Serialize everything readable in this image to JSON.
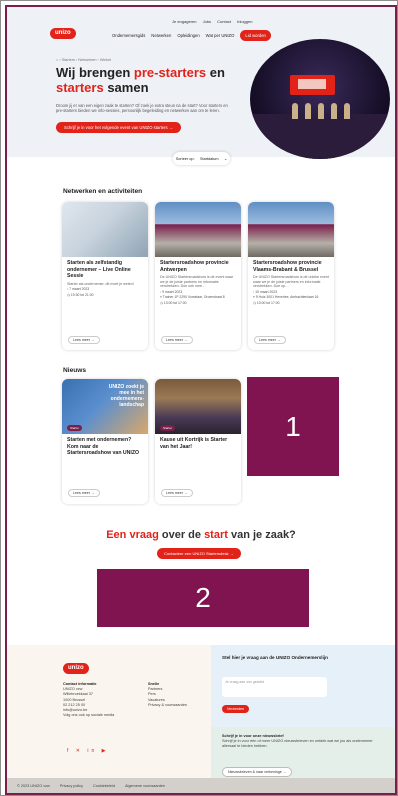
{
  "header": {
    "logo": "unizo",
    "top_nav": [
      "Je engageren",
      "Jobs",
      "Contact",
      "Inloggen"
    ],
    "main_nav": [
      "Ondernemersgids",
      "Netwerken",
      "Opleidingen",
      "Wat per UNIZO"
    ],
    "nav_cta": "Lid worden",
    "breadcrumb": "⌂ › Starters › Netwerken › Winkel"
  },
  "hero": {
    "title_part1": "Wij brengen ",
    "title_highlight1": "pre-starters",
    "title_part2": " en ",
    "title_highlight2": "starters",
    "title_part3": " samen",
    "description": "Droom jij er van een eigen zaak te starten? Of zoek je extra steun na de start? Voor starters en pre-starters bieden we info-sessies, persoonlijk begeleiding en netwerken aan om te leren.",
    "button": "Schrijf je in voor het volgende event van UNIZO starters →"
  },
  "filter": {
    "label": "Sorteer op:",
    "value": "Startdatum"
  },
  "events": {
    "title": "Netwerken en activiteiten",
    "cards": [
      {
        "title": "Starten als zelfstandig ondernemer – Live Online Sessie",
        "desc": "Starter als ondernemer, dit moet je weten!",
        "date": "7 maart 2023",
        "location": "19:30 tot 21:00",
        "more": "Lees meer →"
      },
      {
        "title": "Startersroadshow provincie Antwerpen",
        "desc": "De UNIZO Startersroadshow is dé event waar we je de juiste partners en informatie verstrekken. Doe ook mee…",
        "date": "9 maart 2023",
        "location": "Trainer 1P 2290 Vorselaar, Groenstraat 8",
        "time": "13:00 tot 17:00",
        "more": "Lees meer →"
      },
      {
        "title": "Startersroadshow provincie Vlaams-Brabant & Brussel",
        "desc": "De UNIZO Startersroadshow is dé unieke event waar we je de juiste partners en informatie verstrekken. Doe op…",
        "date": "15 maart 2023",
        "location": "9 Huis 3001 Heverlee, Ambachtenlaan 16",
        "time": "13:00 tot 17:00",
        "more": "Lees meer →"
      }
    ]
  },
  "news": {
    "title": "Nieuws",
    "cards": [
      {
        "tag": "Starter",
        "overlay": "UNIZO zoekt je mee in het ondernemers-landschap",
        "title": "Starten met ondernemen? Kom naar de Startersroadshow van UNIZO",
        "more": "Lees meer →"
      },
      {
        "tag": "Starter",
        "title": "Kause uit Kortrijk is Starter van het Jaar!",
        "more": "Lees meer →"
      }
    ]
  },
  "redactions": {
    "box1": "1",
    "box2": "2"
  },
  "question": {
    "highlight1": "Een vraag",
    "middle": " over de ",
    "highlight2": "start",
    "end": " van je zaak?",
    "button": "Contacteer een UNIZO Startersdesk →"
  },
  "footer": {
    "logo": "unizo",
    "contact_title": "Contact informatie",
    "contact_lines": [
      "UNIZO vzw",
      "Willebroekkaai 37",
      "1000 Brussel",
      "02 212 25 00",
      "info@unizo.be"
    ],
    "social_label": "Volg ons ook op sociale media",
    "social_icons": "f ✕ in ▶",
    "quick_title": "Snelle",
    "quick_links": [
      "Partners",
      "Pers",
      "Vacatures",
      "Privacy & voorwaarden"
    ],
    "question_title": "Stel hier je vraag aan de UNIZO Ondernemerslijn",
    "question_placeholder": "Je vraag aan ons gesteld",
    "question_button": "Verzenden",
    "newsletter_title": "Schrijf je in voor onze nieuwsbrief",
    "newsletter_desc": "Schrijf je in voor één of meer UNIZO nieuwsbrieven en ontdek wat we jou als ondernemer allemaal te bieden hebben.",
    "newsletter_button": "Nieuwsbrieven & naar verkeninge →"
  },
  "bottom_bar": {
    "copyright": "© 2023 UNIZO vzw",
    "links": [
      "Privacy policy",
      "Cookiebeleid",
      "Algemene voorwaarden"
    ]
  },
  "colors": {
    "brand_red": "#e2231a",
    "redaction_maroon": "#7f1450"
  }
}
